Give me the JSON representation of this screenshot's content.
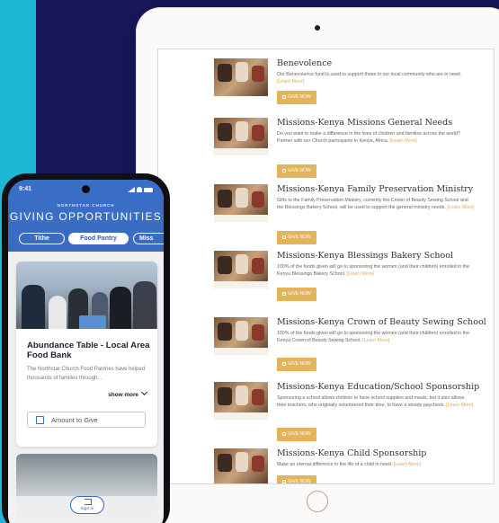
{
  "tablet": {
    "funds": [
      {
        "title": "Benevolence",
        "description": "Our Benevolence fund is used to support those in our local community who are in need.",
        "learn_more": "[Learn More]",
        "button": "GIVE NOW"
      },
      {
        "title": "Missions-Kenya Missions General Needs",
        "description": "Do you want to make a difference in the lives of children and families across the world? Partner with our Church participants in Kenya, Africa.",
        "learn_more": "[Learn More]",
        "button": "GIVE NOW"
      },
      {
        "title": "Missions-Kenya Family Preservation Ministry",
        "description": "Gifts to the Family Preservation Ministry, currently the Crown of Beauty Sewing School and the Blessings Bakery School, will be used to support the general ministry needs.",
        "learn_more": "[Learn More]",
        "button": "GIVE NOW"
      },
      {
        "title": "Missions-Kenya Blessings Bakery School",
        "description": "100% of the funds given will go to sponsoring the women (and their children) enrolled in the Kenya Blessings Bakery School.",
        "learn_more": "[Learn More]",
        "button": "GIVE NOW"
      },
      {
        "title": "Missions-Kenya Crown of Beauty Sewing School",
        "description": "100% of the funds given will go to sponsoring the women (and their children) enrolled in the Kenya Crown of Beauty Sewing School.",
        "learn_more": "[Learn More]",
        "button": "GIVE NOW"
      },
      {
        "title": "Missions-Kenya Education/School Sponsorship",
        "description": "Sponsoring a school allows children to have school supplies and meals, but it also allows their teachers, who originally volunteered their time, to have a steady paycheck.",
        "learn_more": "[Learn More]",
        "button": "GIVE NOW"
      },
      {
        "title": "Missions-Kenya Child Sponsorship",
        "description": "Make an eternal difference in the life of a child in need.",
        "learn_more": "[Learn More]",
        "button": "GIVE NOW"
      }
    ]
  },
  "phone": {
    "status_time": "9:41",
    "church_name": "NORTHSTAR CHURCH",
    "page_title": "GIVING OPPORTUNITIES",
    "tabs": [
      "Tithe",
      "Food Pantry",
      "Miss"
    ],
    "active_tab": "Food Pantry",
    "card": {
      "title": "Abundance Table - Local Area Food Bank",
      "description": "The Northstar Church Food Pantries have helped thousands of families through...",
      "show_more": "show more",
      "amount_placeholder": "Amount to Give"
    },
    "signin_label": "Sign In"
  },
  "colors": {
    "background_navy": "#17175a",
    "accent_cyan": "#1cb8d6",
    "give_button_gold": "#e4b45b",
    "phone_blue": "#3a6bc0"
  }
}
